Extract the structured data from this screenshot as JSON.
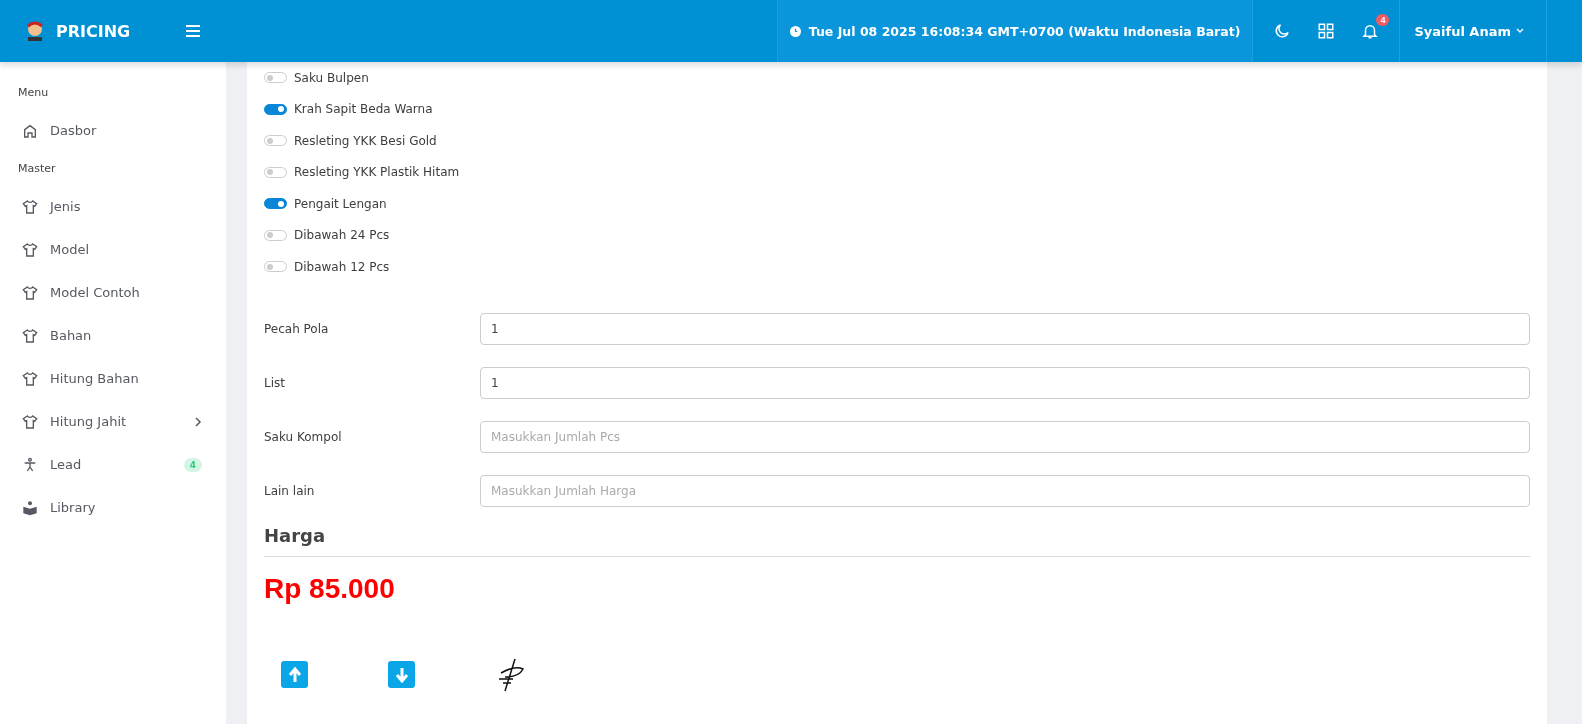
{
  "header": {
    "brand": "PRICING",
    "datetime": "Tue Jul 08 2025 16:08:34 GMT+0700 (Waktu Indonesia Barat)",
    "notification_count": "4",
    "user": "Syaiful Anam"
  },
  "sidebar": {
    "sections": [
      {
        "title": "Menu",
        "items": [
          {
            "label": "Dasbor",
            "kind": "home",
            "expandable": false
          }
        ]
      },
      {
        "title": "Master",
        "items": [
          {
            "label": "Jenis",
            "kind": "shirt",
            "expandable": false
          },
          {
            "label": "Model",
            "kind": "shirt",
            "expandable": false
          },
          {
            "label": "Model Contoh",
            "kind": "shirt",
            "expandable": false
          },
          {
            "label": "Bahan",
            "kind": "shirt",
            "expandable": false
          },
          {
            "label": "Hitung Bahan",
            "kind": "shirt",
            "expandable": false
          },
          {
            "label": "Hitung Jahit",
            "kind": "shirt",
            "expandable": true
          },
          {
            "label": "Lead",
            "kind": "person",
            "expandable": false,
            "badge": "4"
          },
          {
            "label": "Library",
            "kind": "book",
            "expandable": false
          }
        ]
      }
    ]
  },
  "options": [
    {
      "label": "Saku Bulpen",
      "on": false
    },
    {
      "label": "Krah Sapit Beda Warna",
      "on": true
    },
    {
      "label": "Resleting YKK Besi Gold",
      "on": false
    },
    {
      "label": "Resleting YKK Plastik Hitam",
      "on": false
    },
    {
      "label": "Pengait Lengan",
      "on": true
    },
    {
      "label": "Dibawah 24 Pcs",
      "on": false
    },
    {
      "label": "Dibawah 12 Pcs",
      "on": false
    }
  ],
  "fields": [
    {
      "label": "Pecah Pola",
      "value": "1"
    },
    {
      "label": "List",
      "value": "1"
    },
    {
      "label": "Saku Kompol",
      "placeholder": "Masukkan Jumlah Pcs"
    },
    {
      "label": "Lain lain",
      "placeholder": "Masukkan Jumlah Harga"
    }
  ],
  "price": {
    "heading": "Harga",
    "amount": "Rp 85.000"
  }
}
